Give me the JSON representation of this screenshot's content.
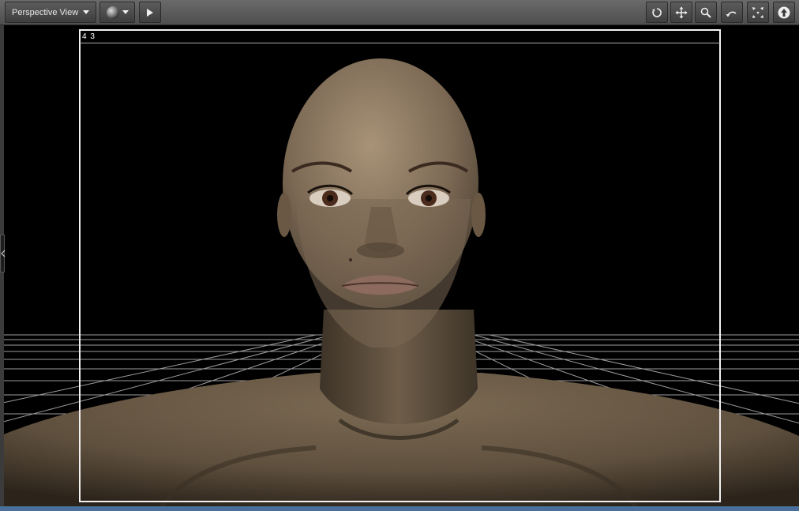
{
  "toolbar": {
    "view_label": "Perspective View",
    "render_icon": "sphere-render-icon",
    "play_icon": "play-icon",
    "nav_icons": [
      "orbit-icon",
      "pan-icon",
      "zoom-icon",
      "roll-icon",
      "frame-icon",
      "home-icon"
    ]
  },
  "viewport": {
    "aspect_ratio_label": "4  3",
    "camera": "Perspective View"
  },
  "colors": {
    "background": "#000000",
    "frame": "#f2f2f2",
    "grid": "#b8b8b8",
    "skin": "#8a7560",
    "accent_bar": "#4a6f9a"
  }
}
